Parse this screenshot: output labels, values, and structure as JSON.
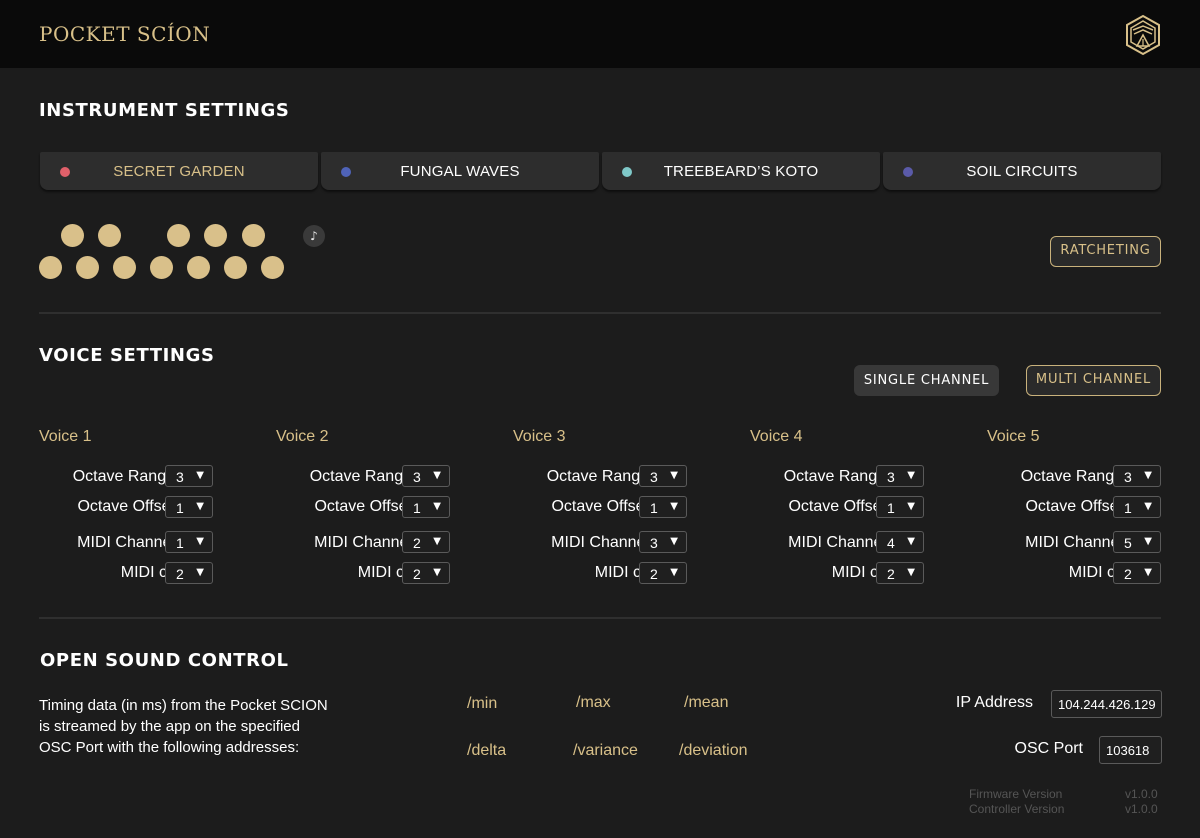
{
  "header": {
    "app_title": "POCKET SCÍON",
    "logo_icon": "hexagon-temple-logo-icon"
  },
  "instrument": {
    "section_title": "INSTRUMENT SETTINGS",
    "presets": [
      {
        "label": "SECRET GARDEN",
        "dot_color": "#e0606a",
        "active": true
      },
      {
        "label": "FUNGAL WAVES",
        "dot_color": "#4f63b8",
        "active": false
      },
      {
        "label": "TREEBEARD’S KOTO",
        "dot_color": "#7fc8c8",
        "active": false
      },
      {
        "label": "SOIL CIRCUITS",
        "dot_color": "#5a5aa8",
        "active": false
      }
    ],
    "note_icon": "♪",
    "ratcheting_label": "RATCHETING"
  },
  "voice": {
    "section_title": "VOICE SETTINGS",
    "single_channel_label": "SINGLE CHANNEL",
    "multi_channel_label": "MULTI CHANNEL",
    "row_labels": {
      "octave_range": "Octave Range",
      "octave_offset": "Octave Offset",
      "midi_channel": "MIDI Channel",
      "midi_cc": "MIDI cc"
    },
    "voices": [
      {
        "title": "Voice 1",
        "octave_range": "3",
        "octave_offset": "1",
        "midi_channel": "1",
        "midi_cc": "2"
      },
      {
        "title": "Voice 2",
        "octave_range": "3",
        "octave_offset": "1",
        "midi_channel": "2",
        "midi_cc": "2"
      },
      {
        "title": "Voice 3",
        "octave_range": "3",
        "octave_offset": "1",
        "midi_channel": "3",
        "midi_cc": "2"
      },
      {
        "title": "Voice 4",
        "octave_range": "3",
        "octave_offset": "1",
        "midi_channel": "4",
        "midi_cc": "2"
      },
      {
        "title": "Voice 5",
        "octave_range": "3",
        "octave_offset": "1",
        "midi_channel": "5",
        "midi_cc": "2"
      }
    ]
  },
  "osc": {
    "section_title": "OPEN SOUND CONTROL",
    "description": "Timing data (in ms) from the Pocket SCION is streamed by the app on the specified OSC Port with the following addresses:",
    "addresses": [
      "/min",
      "/max",
      "/mean",
      "/delta",
      "/variance",
      "/deviation"
    ],
    "ip_label": "IP Address",
    "ip_value": "104.244.426.129",
    "port_label": "OSC Port",
    "port_value": "103618",
    "firmware_label": "Firmware Version",
    "firmware_value": "v1.0.0",
    "controller_label": "Controller Version",
    "controller_value": "v1.0.0"
  },
  "colors": {
    "accent": "#d8c089",
    "background": "#1c1c1c",
    "header_bg": "#0a0a0a",
    "panel": "#2d2d2d"
  }
}
